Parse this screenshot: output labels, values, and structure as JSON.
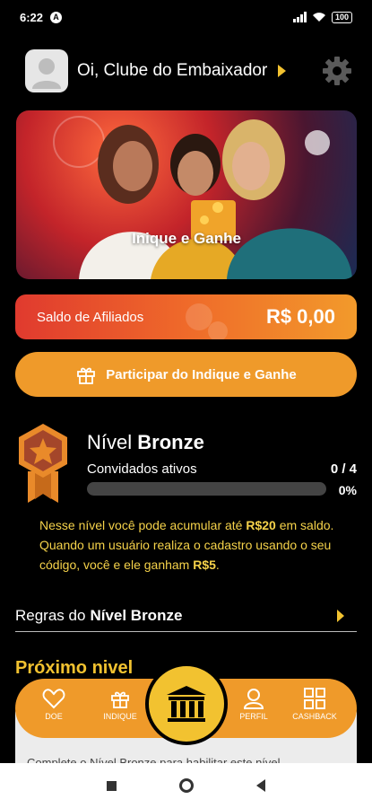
{
  "status_bar": {
    "time": "6:22",
    "notif": "A",
    "battery": "100"
  },
  "header": {
    "greeting": "Oi, Clube do Embaixador"
  },
  "banner": {
    "label": "Inique e Ganhe"
  },
  "saldo": {
    "label": "Saldo de Afiliados",
    "value": "R$ 0,00"
  },
  "participar": {
    "label": "Participar do Indique e Ganhe"
  },
  "level": {
    "prefix": "Nível",
    "name": "Bronze",
    "invited_label": "Convidados ativos",
    "invited_count": "0 / 4",
    "progress_fraction": 0,
    "progress_label": "0%",
    "desc_1": "Nesse nível você pode acumular até ",
    "desc_amount": "R$20",
    "desc_2": " em saldo. Quando um usuário realiza o cadastro usando o seu código, você e ele ganham ",
    "desc_bonus": "R$5",
    "desc_3": "."
  },
  "rules": {
    "prefix": "Regras do",
    "name": "Nível Bronze"
  },
  "next_level": {
    "title": "Próximo nivel",
    "text": "Complete o Nível Bronze para habilitar este nível"
  },
  "nav": {
    "doe": "DOE",
    "indique": "INDIQUE",
    "perfil": "PERFIL",
    "cashback": "CASHBACK"
  },
  "colors": {
    "accent": "#f2c230",
    "orange": "#ef9a2a",
    "saldo_start": "#e03a2e"
  }
}
